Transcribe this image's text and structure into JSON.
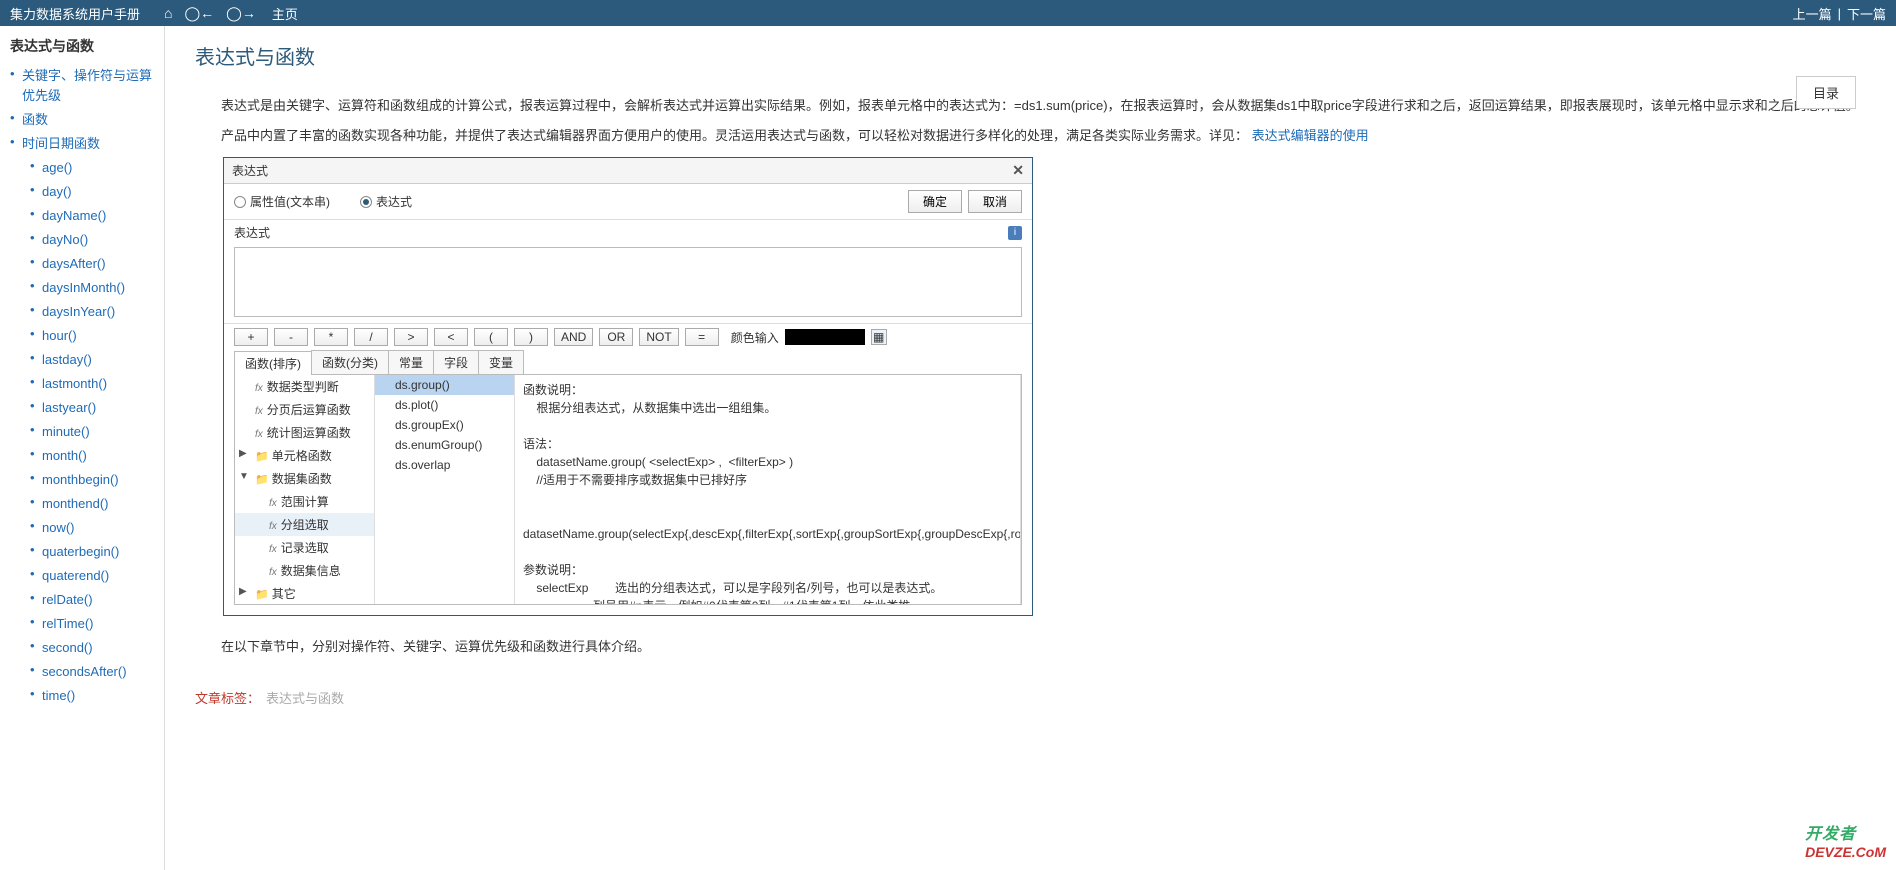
{
  "header": {
    "app_title": "集力数据系统用户手册",
    "home_label": "主页",
    "prev_label": "上一篇",
    "next_label": "下一篇"
  },
  "sidebar": {
    "title": "表达式与函数",
    "items": [
      {
        "label": "关键字、操作符与运算优先级"
      },
      {
        "label": "函数"
      },
      {
        "label": "时间日期函数",
        "children": [
          "age()",
          "day()",
          "dayName()",
          "dayNo()",
          "daysAfter()",
          "daysInMonth()",
          "daysInYear()",
          "hour()",
          "lastday()",
          "lastmonth()",
          "lastyear()",
          "minute()",
          "month()",
          "monthbegin()",
          "monthend()",
          "now()",
          "quaterbegin()",
          "quaterend()",
          "relDate()",
          "relTime()",
          "second()",
          "secondsAfter()",
          "time()"
        ]
      }
    ]
  },
  "content": {
    "page_title": "表达式与函数",
    "toc_label": "目录",
    "para1": "表达式是由关键字、运算符和函数组成的计算公式，报表运算过程中，会解析表达式并运算出实际结果。例如，报表单元格中的表达式为：=ds1.sum(price)，在报表运算时，会从数据集ds1中取price字段进行求和之后，返回运算结果，即报表展现时，该单元格中显示求和之后的总计值。",
    "para2_a": "产品中内置了丰富的函数实现各种功能，并提供了表达式编辑器界面方便用户的使用。灵活运用表达式与函数，可以轻松对数据进行多样化的处理，满足各类实际业务需求。详见：",
    "para2_link": "表达式编辑器的使用",
    "para3": "在以下章节中，分别对操作符、关键字、运算优先级和函数进行具体介绍。",
    "tag_label": "文章标签：",
    "tag_value": "表达式与函数"
  },
  "dialog": {
    "title": "表达式",
    "radio1": "属性值(文本串)",
    "radio2": "表达式",
    "ok": "确定",
    "cancel": "取消",
    "section_label": "表达式",
    "ops": [
      "+",
      "-",
      "*",
      "/",
      ">",
      "<",
      "(",
      ")",
      "AND",
      "OR",
      "NOT",
      "="
    ],
    "color_label": "颜色输入",
    "tabs": [
      "函数(排序)",
      "函数(分类)",
      "常量",
      "字段",
      "变量"
    ],
    "tree": [
      {
        "label": "数据类型判断",
        "type": "fx"
      },
      {
        "label": "分页后运算函数",
        "type": "fx"
      },
      {
        "label": "统计图运算函数",
        "type": "fx"
      },
      {
        "label": "单元格函数",
        "type": "folder",
        "arrow": "▶"
      },
      {
        "label": "数据集函数",
        "type": "folder",
        "arrow": "▼",
        "children": [
          {
            "label": "范围计算",
            "type": "fx"
          },
          {
            "label": "分组选取",
            "type": "fx",
            "selected": true
          },
          {
            "label": "记录选取",
            "type": "fx"
          },
          {
            "label": "数据集信息",
            "type": "fx"
          }
        ]
      },
      {
        "label": "其它",
        "type": "folder",
        "arrow": "▶"
      }
    ],
    "funclist": [
      {
        "label": "ds.group()",
        "selected": true
      },
      {
        "label": "ds.plot()"
      },
      {
        "label": "ds.groupEx()"
      },
      {
        "label": "ds.enumGroup()"
      },
      {
        "label": "ds.overlap"
      }
    ],
    "desc": "函数说明：\n    根据分组表达式，从数据集中选出一组组集。\n\n语法：\n    datasetName.group( <selectExp> ,  <filterExp> )\n    //适用于不需要排序或数据集中已排好序\n\n    datasetName.group(selectExp{,descExp{,filterExp{,sortExp{,groupSortExp{,groupDescExp{,rootGroupExp}}}}}})\n\n参数说明：\n    selectExp        选出的分组表达式，可以是字段列名/列号，也可以是表达式。\n                     列号用#n表示，例如#0代表第0列，#1代表第1列，依此类推\n\n    descExp          分组前记录的排序顺序，true为逆序，false为顺序\n    filterExp        过滤表达式\n    sortExp          分组前记录的排序依据表达式"
  },
  "watermark": {
    "top": "开发者",
    "bot": "DEVZE.CoM"
  }
}
